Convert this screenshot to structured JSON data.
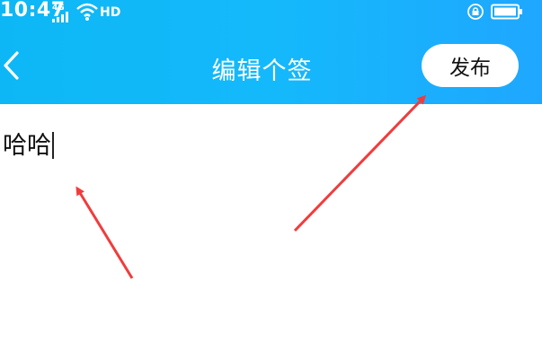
{
  "status_bar": {
    "time": "10:47",
    "network": "4G",
    "hd_label": "HD",
    "icons": [
      "signal-icon",
      "wifi-icon",
      "rotation-lock-icon",
      "battery-icon"
    ]
  },
  "nav": {
    "back_icon": "chevron-left-icon",
    "title": "编辑个签",
    "publish_label": "发布"
  },
  "editor": {
    "value": "哈哈"
  },
  "colors": {
    "header_start": "#0db7f5",
    "header_end": "#1fa7ff",
    "annotation_arrow": "#f03c3c"
  }
}
